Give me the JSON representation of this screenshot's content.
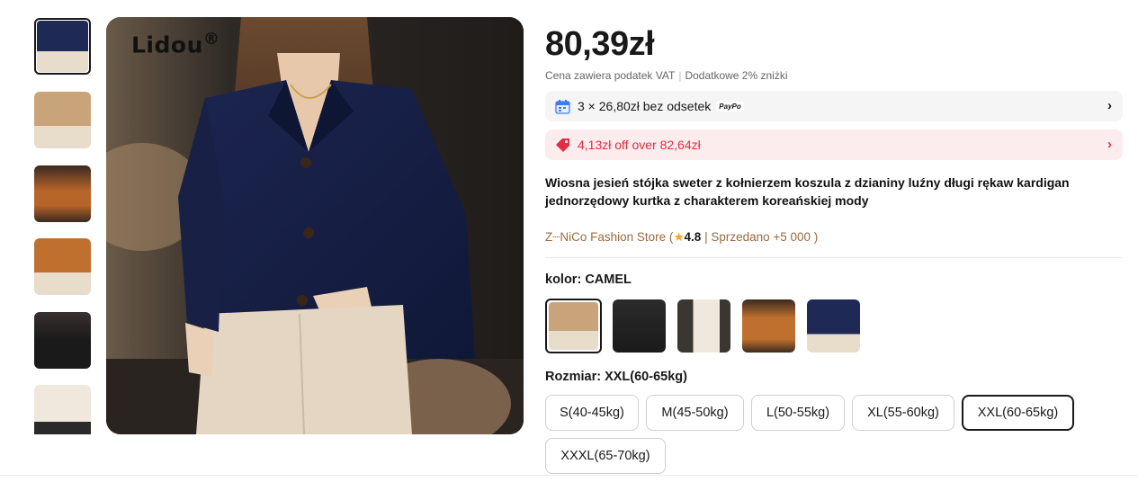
{
  "gallery": {
    "brand_watermark": "Lidou",
    "brand_mark": "®",
    "thumbnails": [
      {
        "colors": [
          "#1e2a55",
          "#e8dccb"
        ],
        "active": true
      },
      {
        "colors": [
          "#c9a47a",
          "#e8dccb"
        ],
        "active": false
      },
      {
        "colors": [
          "#b8652a",
          "#3a2a20"
        ],
        "active": false
      },
      {
        "colors": [
          "#c0702e",
          "#e8dccb"
        ],
        "active": false
      },
      {
        "colors": [
          "#1a1a1a",
          "#3a3030"
        ],
        "active": false
      },
      {
        "colors": [
          "#f0e8dc",
          "#2a2a2a"
        ],
        "active": false
      }
    ]
  },
  "product": {
    "price": "80,39zł",
    "vat_note": "Cena zawiera podatek VAT",
    "vat_sep": "|",
    "extra_discount": "Dodatkowe 2% zniżki",
    "installments_text": "3 × 26,80zł bez odsetek",
    "installments_provider": "PayPo",
    "coupon_text": "4,13zł off over 82,64zł",
    "title": "Wiosna jesień stójka sweter z kołnierzem koszula z dzianiny luźny długi rękaw kardigan jednorzędowy kurtka z charakterem koreańskiej mody"
  },
  "store": {
    "name": "Z┈NiCo Fashion Store (",
    "star": "★",
    "rating": "4.8",
    "sold": " | Sprzedano +5 000 )"
  },
  "color_selector": {
    "label": "kolor:",
    "selected": "CAMEL",
    "options": [
      {
        "colors": [
          "#c9a47a",
          "#e8dccb"
        ],
        "active": true
      },
      {
        "colors": [
          "#1a1a1a",
          "#2b2b2b"
        ],
        "active": false
      },
      {
        "colors": [
          "#f0e8dc",
          "#3a3632"
        ],
        "active": false
      },
      {
        "colors": [
          "#c0702e",
          "#3a2a20"
        ],
        "active": false
      },
      {
        "colors": [
          "#1e2a55",
          "#e8dccb"
        ],
        "active": false
      }
    ]
  },
  "size_selector": {
    "label": "Rozmiar:",
    "selected": "XXL(60-65kg)",
    "options": [
      {
        "label": "S(40-45kg)",
        "active": false
      },
      {
        "label": "M(45-50kg)",
        "active": false
      },
      {
        "label": "L(50-55kg)",
        "active": false
      },
      {
        "label": "XL(55-60kg)",
        "active": false
      },
      {
        "label": "XXL(60-65kg)",
        "active": true
      },
      {
        "label": "XXXL(65-70kg)",
        "active": false
      }
    ]
  },
  "icons": {
    "installments": "calendar-icon",
    "coupon": "tag-icon",
    "chevron": "›"
  },
  "accent_colors": {
    "coupon_red": "#e02e44",
    "store_brown": "#9b6b3d",
    "rating_star": "#f5a623"
  }
}
